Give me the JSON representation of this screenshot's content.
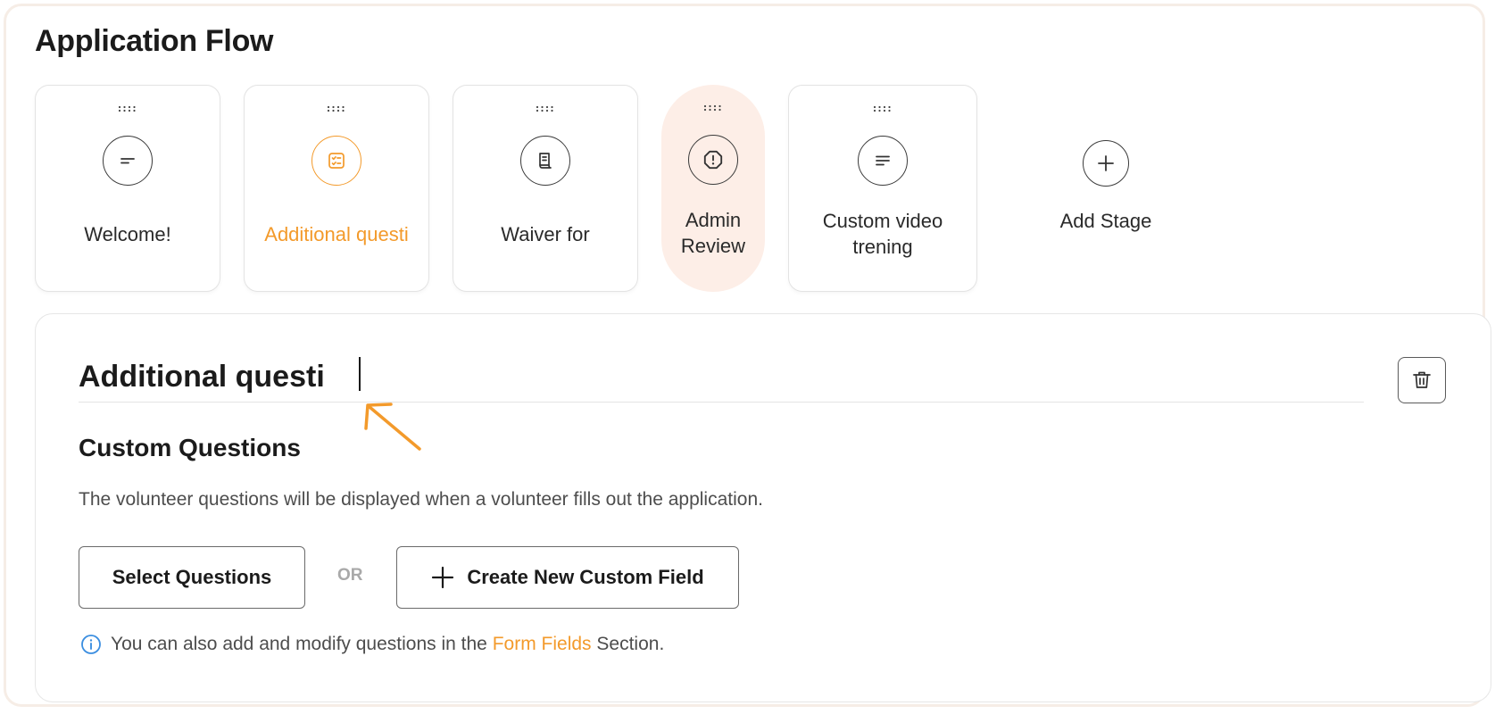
{
  "page": {
    "title": "Application Flow"
  },
  "stages": [
    {
      "label": "Welcome!",
      "icon": "welcome-lines-icon"
    },
    {
      "label": "Additional questi",
      "icon": "checklist-icon",
      "active": true
    },
    {
      "label": "Waiver for",
      "icon": "document-icon"
    },
    {
      "label": "Admin Review",
      "icon": "alert-icon"
    },
    {
      "label": "Custom video trening",
      "icon": "text-lines-icon"
    }
  ],
  "add_stage": {
    "label": "Add Stage"
  },
  "editor": {
    "title_value": "Additional questi",
    "section_title": "Custom Questions",
    "section_desc": "The volunteer questions will be displayed when a volunteer fills out the application.",
    "select_button": "Select Questions",
    "or_label": "OR",
    "create_button": "Create New Custom Field",
    "info_prefix": "You can also add and modify questions in the",
    "info_link": "Form Fields",
    "info_suffix": "Section."
  },
  "colors": {
    "accent": "#f39a2b",
    "pill_bg": "#fdeee7",
    "info_blue": "#3b8ee0"
  }
}
